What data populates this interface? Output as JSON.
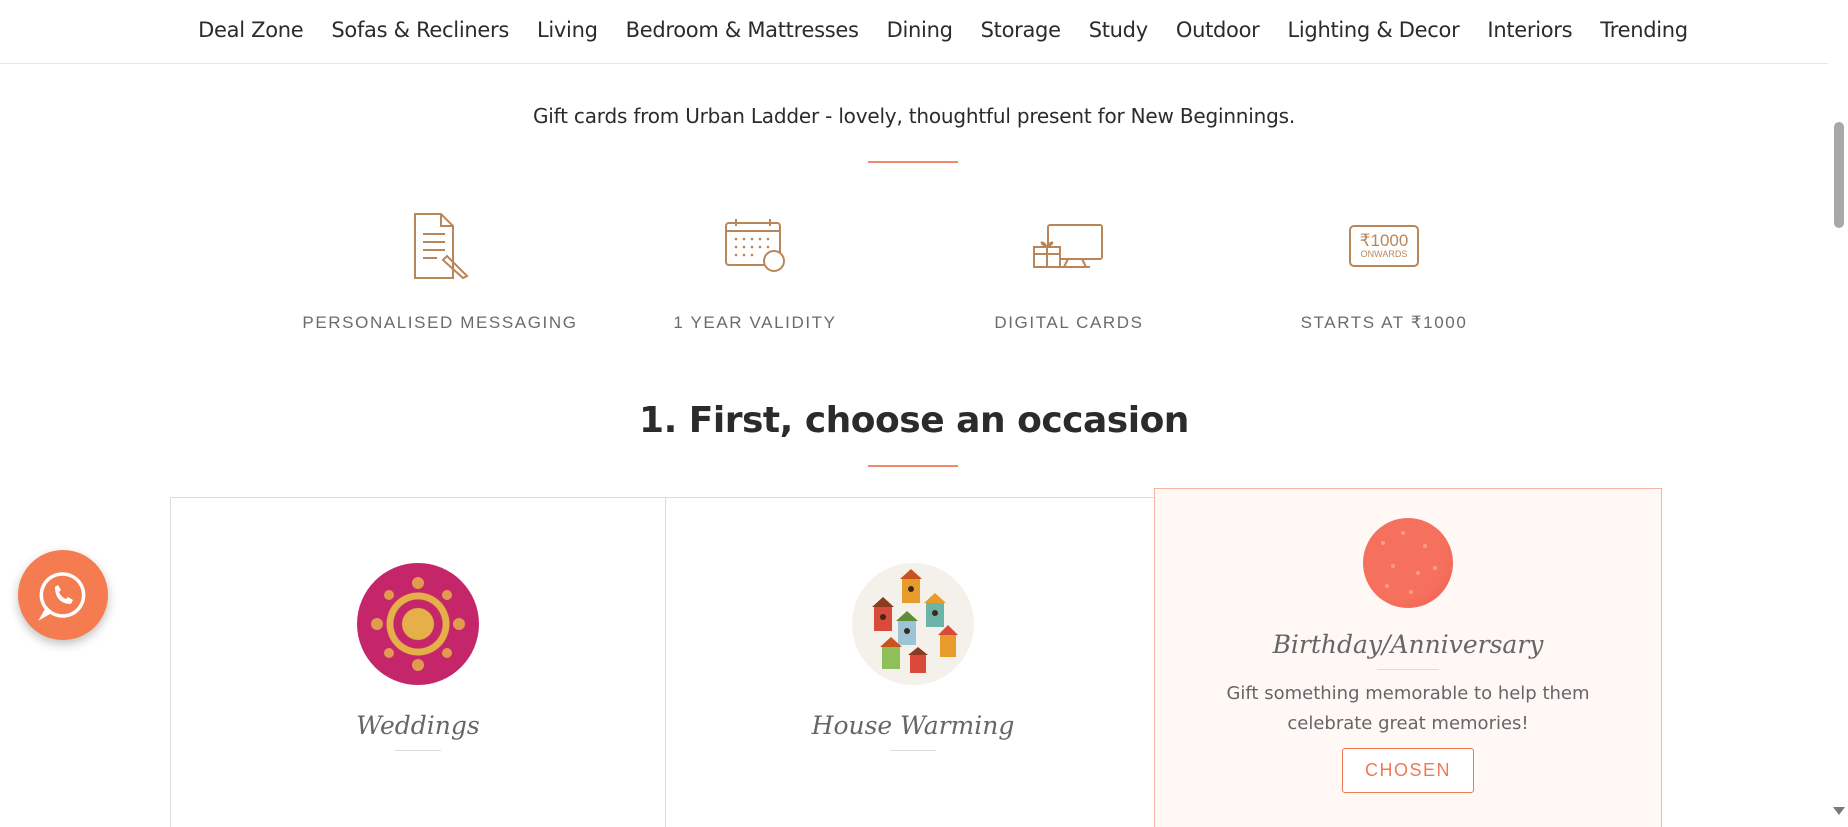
{
  "nav": {
    "items": [
      "Deal Zone",
      "Sofas & Recliners",
      "Living",
      "Bedroom & Mattresses",
      "Dining",
      "Storage",
      "Study",
      "Outdoor",
      "Lighting & Decor",
      "Interiors",
      "Trending"
    ]
  },
  "intro": "Gift cards from Urban Ladder - lovely, thoughtful present for New Beginnings.",
  "features": [
    {
      "icon": "document-pen-icon",
      "label": "PERSONALISED MESSAGING"
    },
    {
      "icon": "calendar-icon",
      "label": "1 YEAR VALIDITY"
    },
    {
      "icon": "digital-gift-monitor-icon",
      "label": "DIGITAL CARDS"
    },
    {
      "icon": "price-tag-icon",
      "label": "STARTS AT ₹1000",
      "badge_top": "₹1000",
      "badge_bottom": "ONWARDS"
    }
  ],
  "heading": "1. First, choose an occasion",
  "occasions": [
    {
      "name": "Weddings",
      "chosen": false
    },
    {
      "name": "House Warming",
      "chosen": false
    },
    {
      "name": "Birthday/Anniversary",
      "chosen": true,
      "description": "Gift something memorable to help them celebrate great memories!",
      "button": "CHOSEN"
    }
  ],
  "colors": {
    "accent": "#ef7a55",
    "icon_brown": "#b9865a",
    "chosen_bg": "#fff8f5",
    "whatsapp": "#f57c51"
  }
}
